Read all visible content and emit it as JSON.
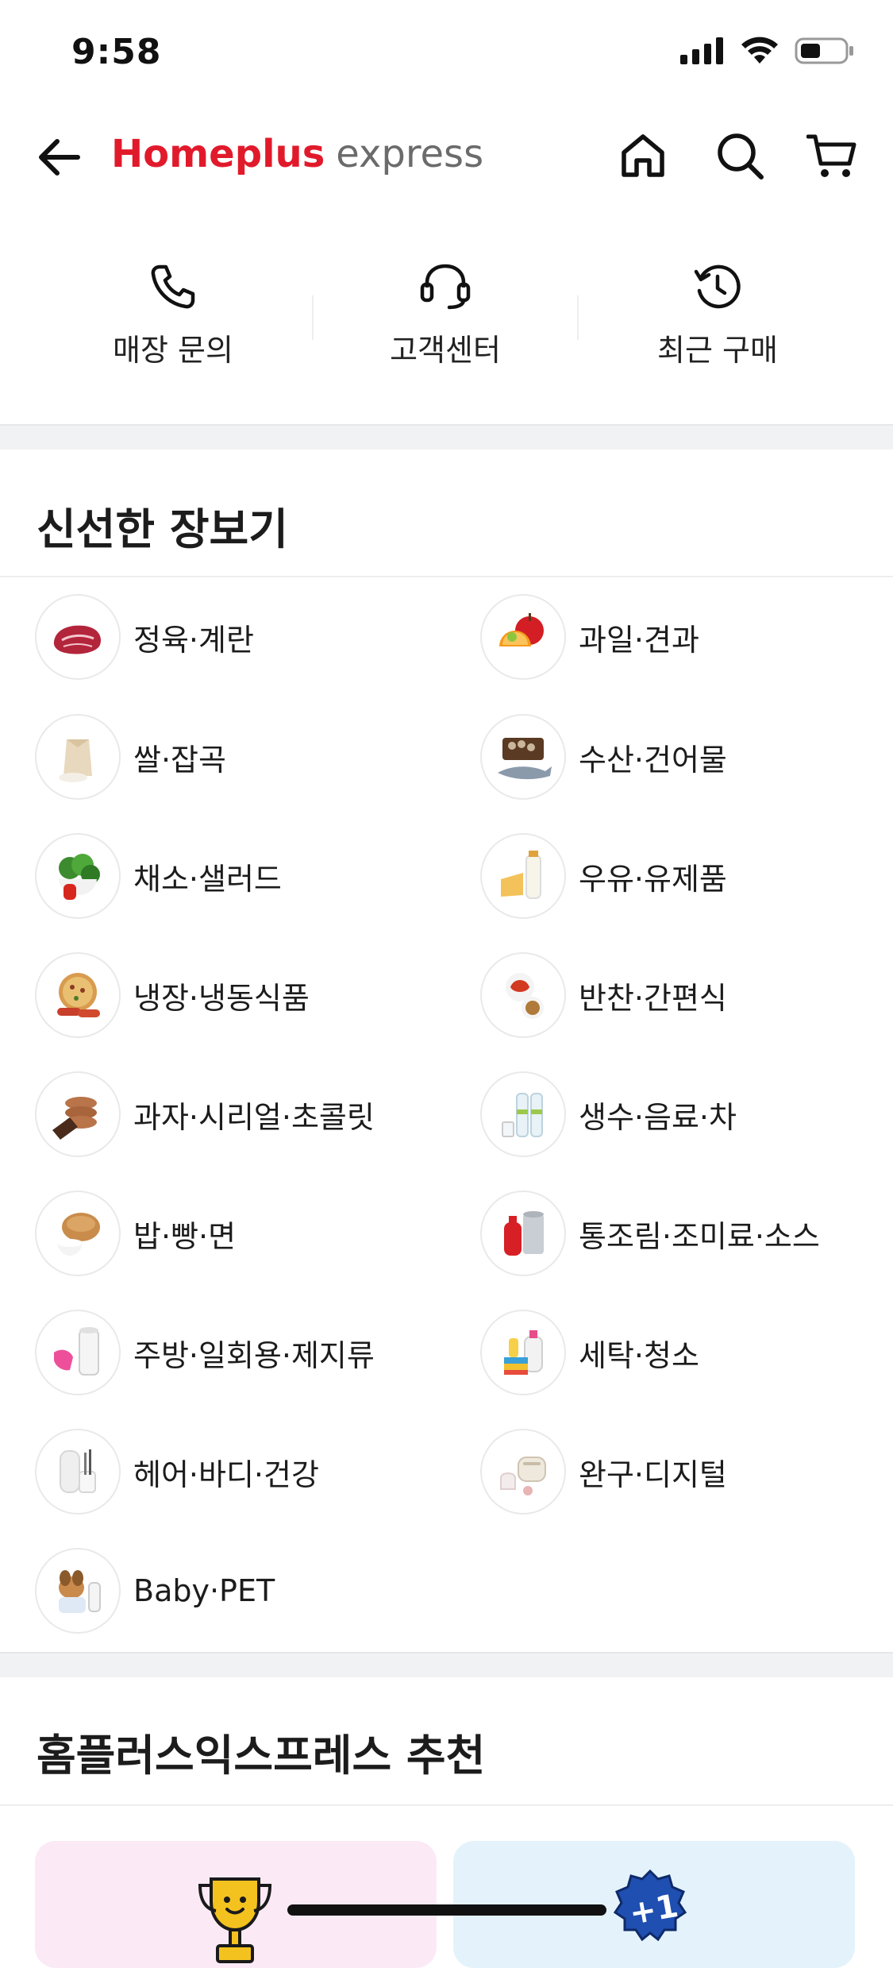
{
  "status": {
    "time": "9:58"
  },
  "header": {
    "brand_main": "Homeplus",
    "brand_sub": "express"
  },
  "quick_actions": [
    {
      "label": "매장 문의",
      "icon": "phone-icon"
    },
    {
      "label": "고객센터",
      "icon": "headset-icon"
    },
    {
      "label": "최근 구매",
      "icon": "history-icon"
    }
  ],
  "fresh": {
    "title": "신선한 장보기",
    "categories": [
      {
        "label": "정육·계란",
        "icon": "meat-icon"
      },
      {
        "label": "과일·견과",
        "icon": "fruit-icon"
      },
      {
        "label": "쌀·잡곡",
        "icon": "rice-icon"
      },
      {
        "label": "수산·건어물",
        "icon": "fish-icon"
      },
      {
        "label": "채소·샐러드",
        "icon": "vegetable-icon"
      },
      {
        "label": "우유·유제품",
        "icon": "milk-icon"
      },
      {
        "label": "냉장·냉동식품",
        "icon": "pizza-icon"
      },
      {
        "label": "반찬·간편식",
        "icon": "kimchi-icon"
      },
      {
        "label": "과자·시리얼·초콜릿",
        "icon": "cookie-icon"
      },
      {
        "label": "생수·음료·차",
        "icon": "water-bottle-icon"
      },
      {
        "label": "밥·빵·면",
        "icon": "bread-icon"
      },
      {
        "label": "통조림·조미료·소스",
        "icon": "can-icon"
      },
      {
        "label": "주방·일회용·제지류",
        "icon": "paper-towel-icon"
      },
      {
        "label": "세탁·청소",
        "icon": "detergent-icon"
      },
      {
        "label": "헤어·바디·건강",
        "icon": "toothbrush-icon"
      },
      {
        "label": "완구·디지털",
        "icon": "appliance-icon"
      },
      {
        "label": "Baby·PET",
        "icon": "puppy-icon"
      }
    ]
  },
  "recommend": {
    "title": "홈플러스익스프레스 추천",
    "badge": "+1"
  },
  "colors": {
    "brand_red": "#e11a2b",
    "card_pink": "#fbeaf6",
    "card_blue": "#e4f3fb"
  }
}
